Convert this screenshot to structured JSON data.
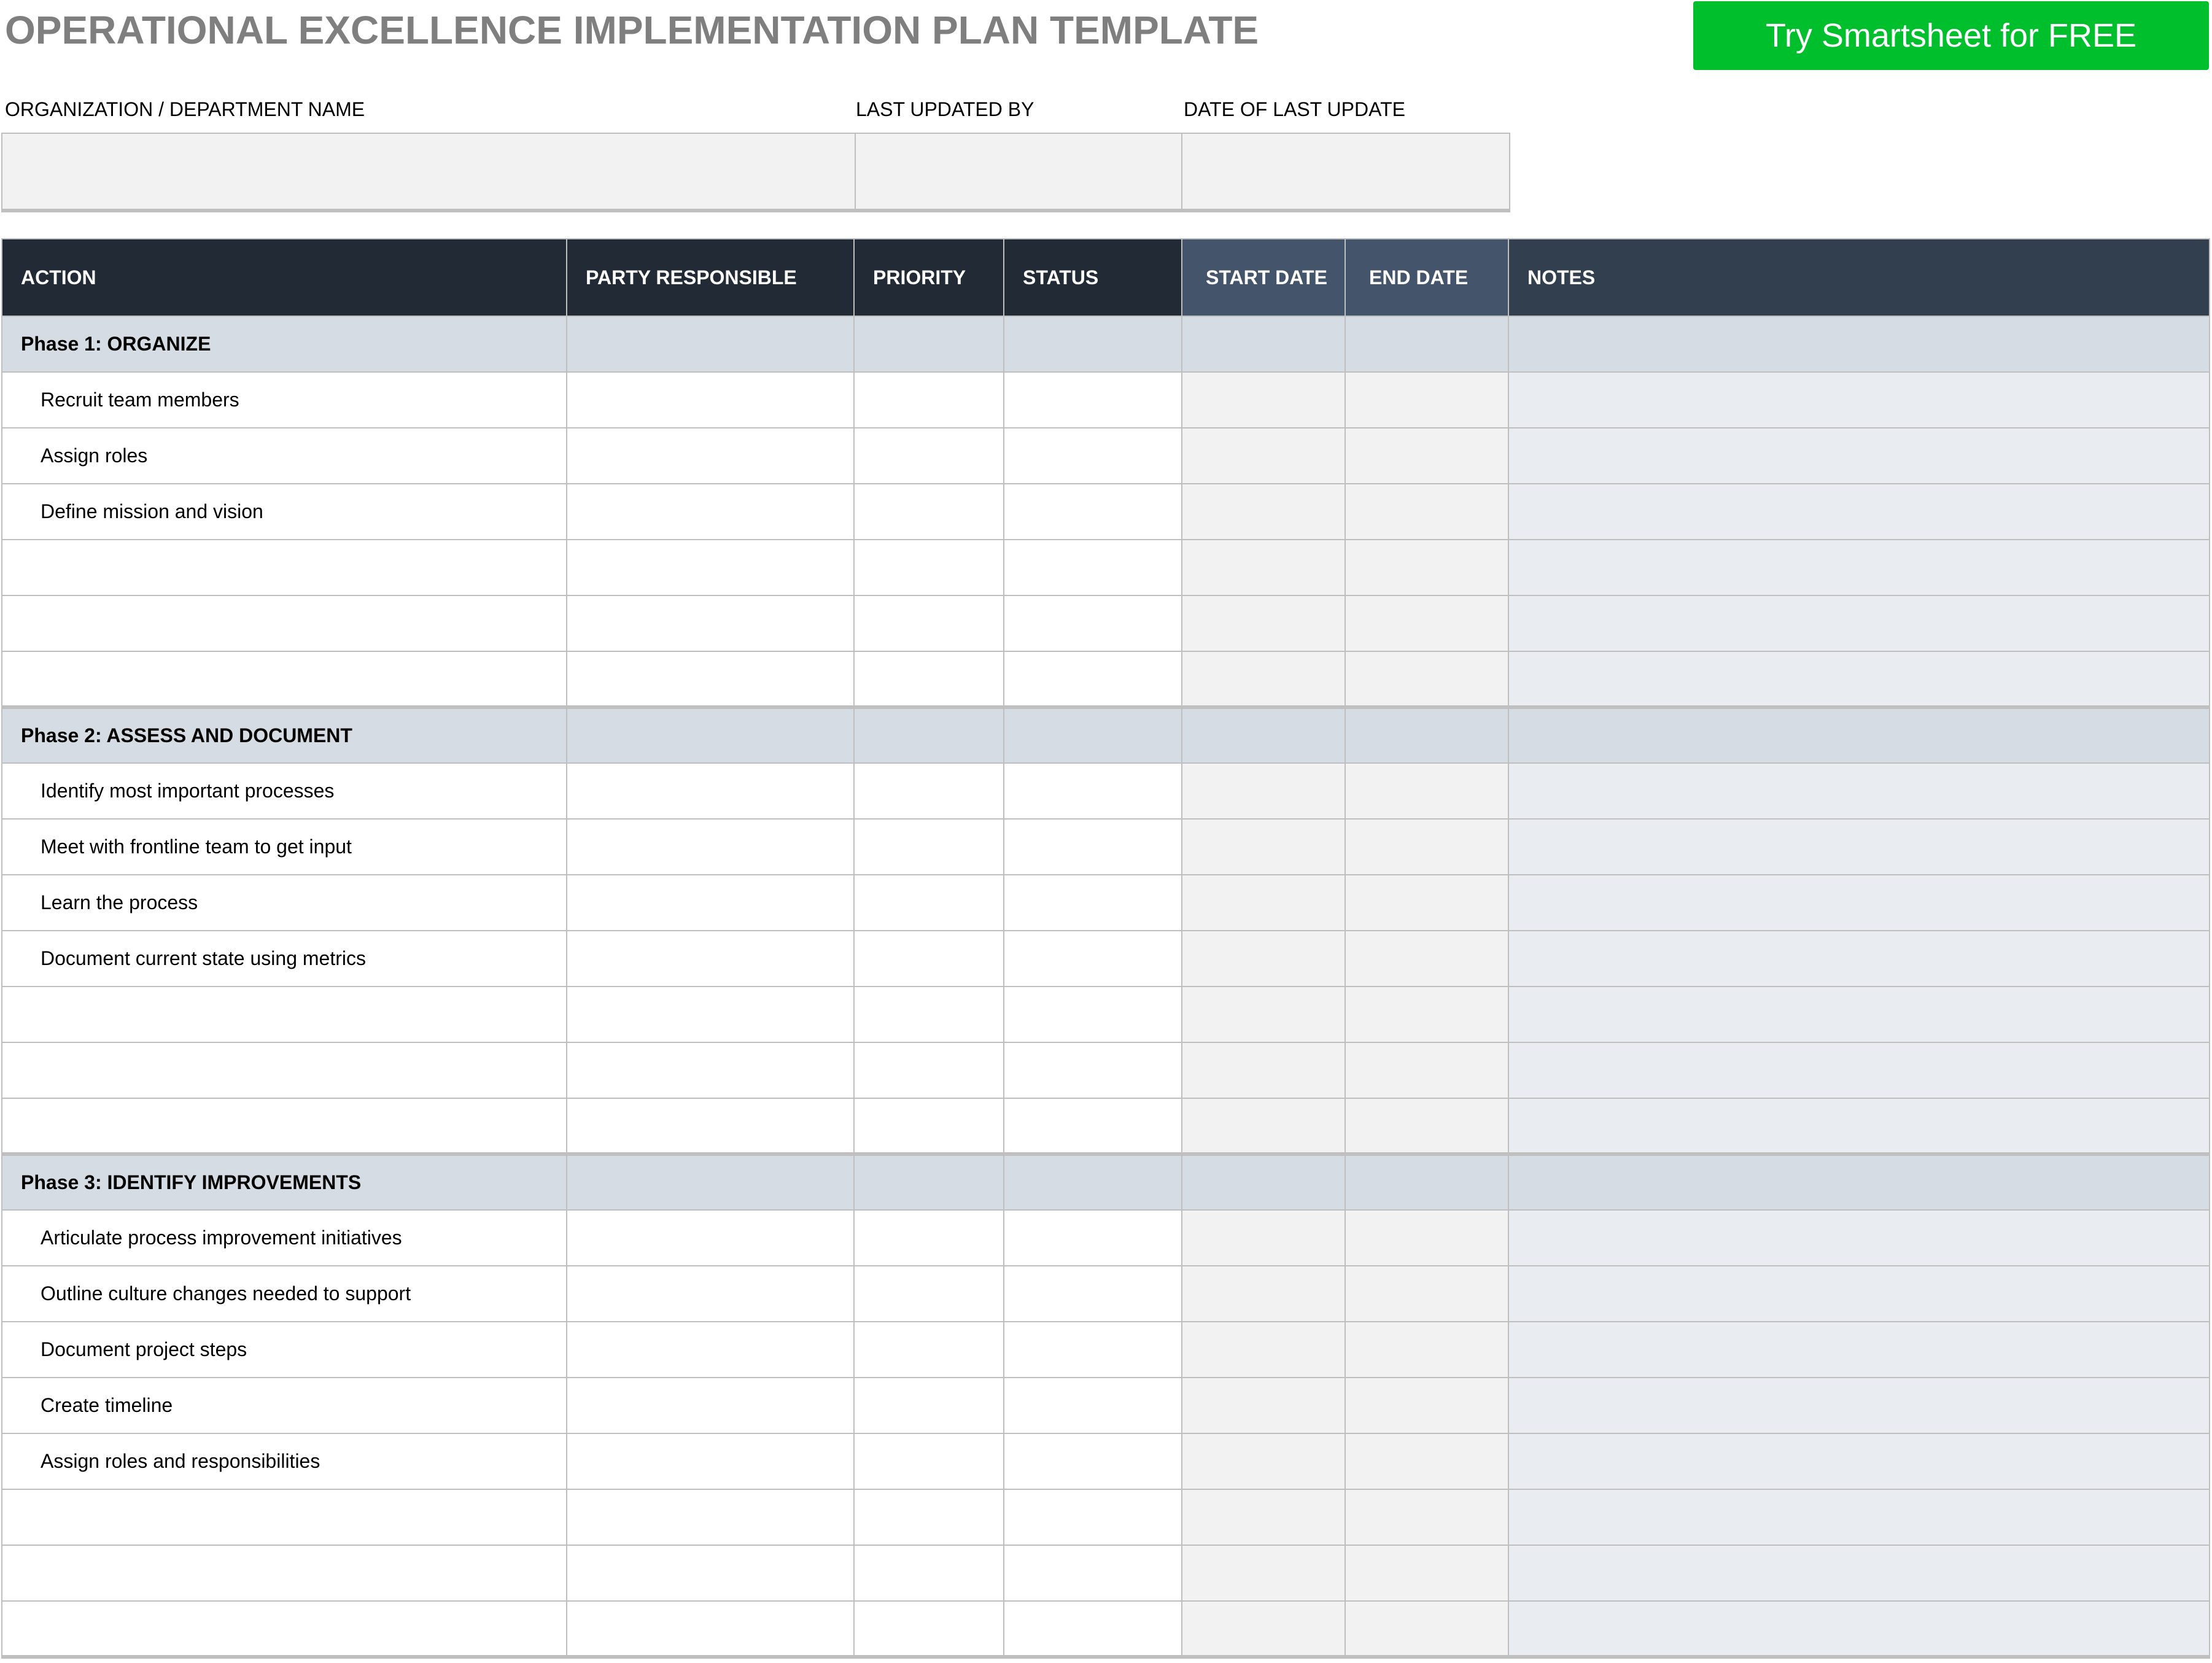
{
  "title": "OPERATIONAL EXCELLENCE IMPLEMENTATION PLAN TEMPLATE",
  "cta": {
    "label": "Try Smartsheet for FREE",
    "color": "#00bf2d"
  },
  "meta": {
    "org_label": "ORGANIZATION / DEPARTMENT NAME",
    "updated_by_label": "LAST UPDATED BY",
    "date_label": "DATE OF LAST UPDATE",
    "org_value": "",
    "updated_by_value": "",
    "date_value": ""
  },
  "columns": {
    "action": "ACTION",
    "party": "PARTY RESPONSIBLE",
    "priority": "PRIORITY",
    "status": "STATUS",
    "start": "START DATE",
    "end": "END DATE",
    "notes": "NOTES"
  },
  "colors": {
    "header_dark": "#222a35",
    "header_date": "#44546a",
    "header_notes": "#323f4f",
    "phase_row": "#d6dce4",
    "date_cells": "#f2f2f2",
    "notes_cells": "#e9ecf1",
    "title_gray": "#7f7f7f"
  },
  "phases": [
    {
      "label": "Phase 1: ORGANIZE",
      "tasks": [
        "Recruit team members",
        "Assign roles",
        "Define mission and vision",
        "",
        "",
        ""
      ]
    },
    {
      "label": "Phase 2: ASSESS AND DOCUMENT",
      "tasks": [
        "Identify most important processes",
        "Meet with frontline team to get input",
        "Learn the process",
        "Document current state using metrics",
        "",
        "",
        ""
      ]
    },
    {
      "label": "Phase 3: IDENTIFY IMPROVEMENTS",
      "tasks": [
        "Articulate process improvement initiatives",
        "Outline culture changes needed to support",
        "Document project steps",
        "Create timeline",
        "Assign roles and responsibilities",
        "",
        "",
        ""
      ]
    }
  ]
}
